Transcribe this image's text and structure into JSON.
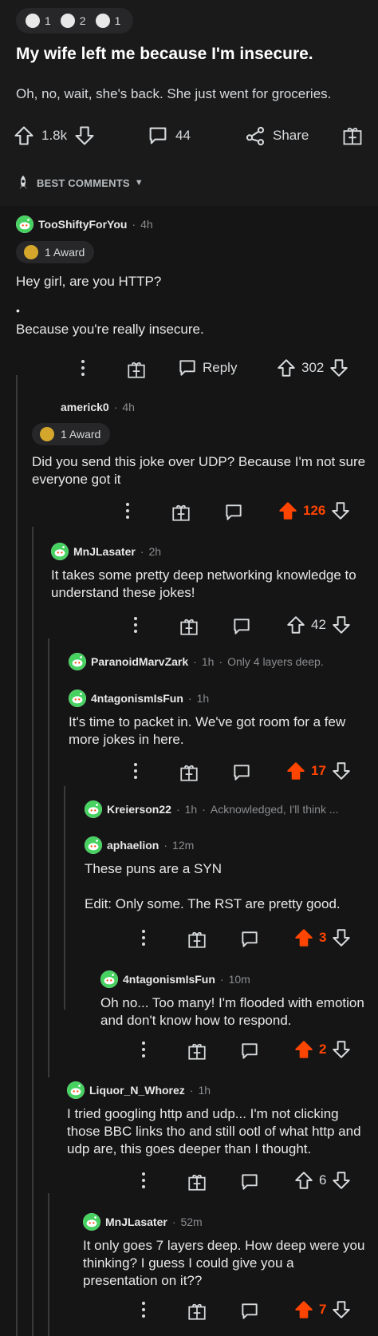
{
  "post": {
    "awards": [
      "1",
      "2",
      "1"
    ],
    "title": "My wife left me because I'm insecure.",
    "body": "Oh, no, wait, she's back. She just went for groceries.",
    "upvotes": "1.8k",
    "comments": "44",
    "share": "Share"
  },
  "sort": {
    "label": "BEST COMMENTS"
  },
  "comments": [
    {
      "user": "TooShiftyForYou",
      "time": "4h",
      "award": "1 Award",
      "text1": "Hey girl, are you HTTP?",
      "bullet": "•",
      "text2": "Because you're really insecure.",
      "reply": "Reply",
      "score": "302"
    },
    {
      "user": "americk0",
      "time": "4h",
      "award": "1 Award",
      "text": "Did you send this joke over UDP? Because I'm not sure everyone got it",
      "score": "126"
    },
    {
      "user": "MnJLasater",
      "time": "2h",
      "text": "It takes some pretty deep networking knowledge to understand these jokes!",
      "score": "42"
    },
    {
      "user": "ParanoidMarvZark",
      "time": "1h",
      "preview": "Only 4 layers deep."
    },
    {
      "user": "4ntagonismIsFun",
      "time": "1h",
      "text": "It's time to packet in. We've got room for a few more jokes in here.",
      "score": "17"
    },
    {
      "user": "Kreierson22",
      "time": "1h",
      "preview": "Acknowledged, I'll think ..."
    },
    {
      "user": "aphaelion",
      "time": "12m",
      "text1": "These puns are a SYN",
      "text2": "Edit: Only some. The RST are pretty good.",
      "score": "3"
    },
    {
      "user": "4ntagonismIsFun",
      "time": "10m",
      "text": "Oh no... Too many! I'm flooded with emotion and don't know how to respond.",
      "score": "2"
    },
    {
      "user": "Liquor_N_Whorez",
      "time": "1h",
      "text": "I tried googling http and udp... I'm not clicking those BBC links tho and still ootl of what http and udp are, this goes deeper than I thought.",
      "score": "6"
    },
    {
      "user": "MnJLasater",
      "time": "52m",
      "text": "It only goes 7 layers deep.  How deep were you thinking?  I guess I could give you a presentation on it??",
      "score": "7"
    }
  ],
  "colors": {
    "accent": "#ff4500",
    "bg": "#1a1a1b",
    "text": "#d7dadc"
  }
}
